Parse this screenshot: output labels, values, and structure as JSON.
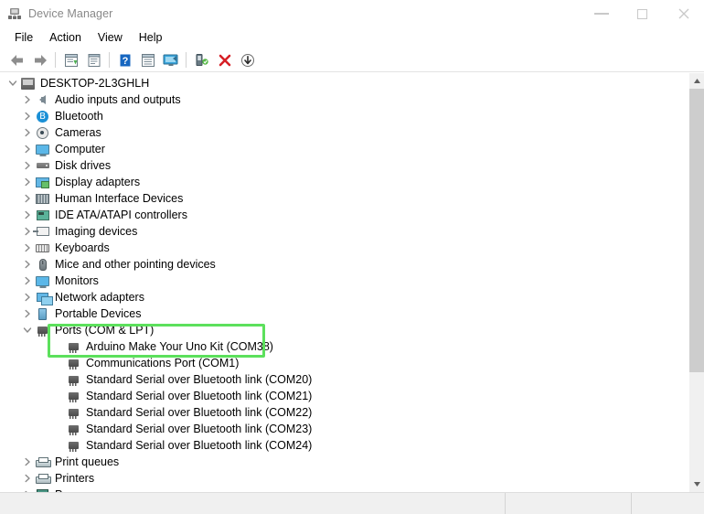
{
  "window": {
    "title": "Device Manager",
    "icon": "device-manager-icon",
    "controls": {
      "minimize": "Minimize",
      "maximize": "Maximize",
      "close": "Close"
    }
  },
  "menubar": {
    "items": [
      {
        "label": "File",
        "name": "menu-file"
      },
      {
        "label": "Action",
        "name": "menu-action"
      },
      {
        "label": "View",
        "name": "menu-view"
      },
      {
        "label": "Help",
        "name": "menu-help"
      }
    ]
  },
  "toolbar": {
    "buttons": [
      {
        "name": "back-button",
        "icon": "arrow-left-icon",
        "title": "Back"
      },
      {
        "name": "forward-button",
        "icon": "arrow-right-icon",
        "title": "Forward"
      },
      {
        "name": "separator-1",
        "icon": "separator"
      },
      {
        "name": "show-hidden-devices-button",
        "icon": "window-list-icon",
        "title": "Show hidden devices"
      },
      {
        "name": "properties-button",
        "icon": "properties-icon",
        "title": "Properties"
      },
      {
        "name": "separator-2",
        "icon": "separator"
      },
      {
        "name": "help-button",
        "icon": "help-question-icon",
        "title": "Help"
      },
      {
        "name": "device-list-button",
        "icon": "device-list-icon",
        "title": "Devices by type"
      },
      {
        "name": "scan-hardware-button",
        "icon": "monitor-scan-icon",
        "title": "Scan for hardware changes"
      },
      {
        "name": "separator-3",
        "icon": "separator"
      },
      {
        "name": "update-driver-button",
        "icon": "update-driver-icon",
        "title": "Update driver"
      },
      {
        "name": "uninstall-device-button",
        "icon": "red-x-icon",
        "title": "Uninstall device"
      },
      {
        "name": "disable-device-button",
        "icon": "download-arrow-icon",
        "title": "Disable device"
      }
    ]
  },
  "tree": {
    "root": {
      "label": "DESKTOP-2L3GHLH",
      "icon": "computer-icon",
      "expanded": true
    },
    "categories": [
      {
        "label": "Audio inputs and outputs",
        "icon": "speaker-icon",
        "expanded": false,
        "name": "tree-item-audio-inputs-and-outputs"
      },
      {
        "label": "Bluetooth",
        "icon": "bluetooth-icon",
        "expanded": false,
        "name": "tree-item-bluetooth"
      },
      {
        "label": "Cameras",
        "icon": "camera-icon",
        "expanded": false,
        "name": "tree-item-cameras"
      },
      {
        "label": "Computer",
        "icon": "monitor-icon",
        "expanded": false,
        "name": "tree-item-computer"
      },
      {
        "label": "Disk drives",
        "icon": "disk-drive-icon",
        "expanded": false,
        "name": "tree-item-disk-drives"
      },
      {
        "label": "Display adapters",
        "icon": "display-adapter-icon",
        "expanded": false,
        "name": "tree-item-display-adapters"
      },
      {
        "label": "Human Interface Devices",
        "icon": "hid-icon",
        "expanded": false,
        "name": "tree-item-human-interface-devices"
      },
      {
        "label": "IDE ATA/ATAPI controllers",
        "icon": "ide-controller-icon",
        "expanded": false,
        "name": "tree-item-ide-ata-atapi-controllers"
      },
      {
        "label": "Imaging devices",
        "icon": "imaging-device-icon",
        "expanded": false,
        "name": "tree-item-imaging-devices"
      },
      {
        "label": "Keyboards",
        "icon": "keyboard-icon",
        "expanded": false,
        "name": "tree-item-keyboards"
      },
      {
        "label": "Mice and other pointing devices",
        "icon": "mouse-icon",
        "expanded": false,
        "name": "tree-item-mice-and-other-pointing-devices"
      },
      {
        "label": "Monitors",
        "icon": "monitor-icon",
        "expanded": false,
        "name": "tree-item-monitors"
      },
      {
        "label": "Network adapters",
        "icon": "network-adapter-icon",
        "expanded": false,
        "name": "tree-item-network-adapters"
      },
      {
        "label": "Portable Devices",
        "icon": "portable-device-icon",
        "expanded": false,
        "name": "tree-item-portable-devices"
      }
    ],
    "ports_node": {
      "label": "Ports (COM & LPT)",
      "icon": "port-icon",
      "expanded": true,
      "name": "tree-item-ports-com-and-lpt"
    },
    "ports_children": [
      {
        "label": "Arduino Make Your Uno Kit (COM38)",
        "icon": "port-icon",
        "highlighted": true,
        "name": "tree-item-arduino-make-your-uno-kit-com38"
      },
      {
        "label": "Communications Port (COM1)",
        "icon": "port-icon",
        "highlighted": false,
        "name": "tree-item-communications-port-com1"
      },
      {
        "label": "Standard Serial over Bluetooth link (COM20)",
        "icon": "port-icon",
        "highlighted": false,
        "name": "tree-item-standard-serial-bluetooth-com20"
      },
      {
        "label": "Standard Serial over Bluetooth link (COM21)",
        "icon": "port-icon",
        "highlighted": false,
        "name": "tree-item-standard-serial-bluetooth-com21"
      },
      {
        "label": "Standard Serial over Bluetooth link (COM22)",
        "icon": "port-icon",
        "highlighted": false,
        "name": "tree-item-standard-serial-bluetooth-com22"
      },
      {
        "label": "Standard Serial over Bluetooth link (COM23)",
        "icon": "port-icon",
        "highlighted": false,
        "name": "tree-item-standard-serial-bluetooth-com23"
      },
      {
        "label": "Standard Serial over Bluetooth link (COM24)",
        "icon": "port-icon",
        "highlighted": false,
        "name": "tree-item-standard-serial-bluetooth-com24"
      }
    ],
    "trailing_categories": [
      {
        "label": "Print queues",
        "icon": "printer-icon",
        "expanded": false,
        "name": "tree-item-print-queues"
      },
      {
        "label": "Printers",
        "icon": "printer-icon",
        "expanded": false,
        "name": "tree-item-printers"
      },
      {
        "label": "Processors",
        "icon": "processor-icon",
        "expanded": false,
        "name": "tree-item-processors"
      }
    ]
  },
  "highlight": {
    "color": "#5ce05c",
    "target": "Arduino Make Your Uno Kit (COM38)"
  },
  "statusbar": {
    "main": "",
    "pane2": "",
    "pane3": ""
  },
  "scrollbar": {
    "up_arrow": "scroll-up-icon",
    "down_arrow": "scroll-down-icon"
  }
}
